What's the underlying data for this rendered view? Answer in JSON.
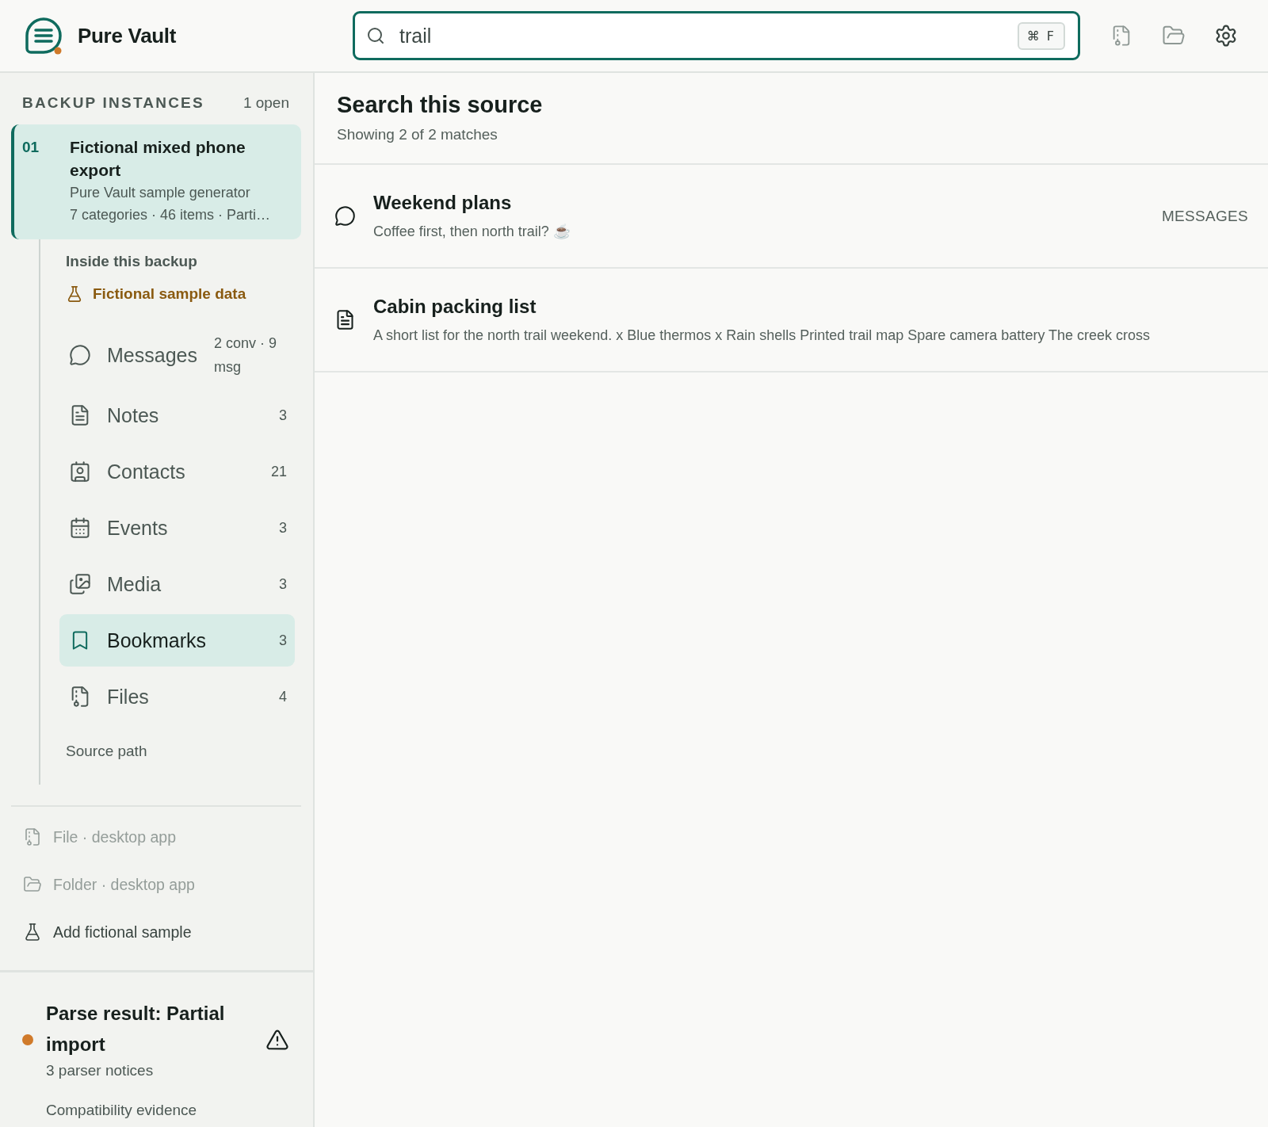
{
  "app": {
    "name": "Pure Vault"
  },
  "search": {
    "value": "trail",
    "shortcut": "⌘ F"
  },
  "sidebar": {
    "heading": "BACKUP INSTANCES",
    "open_count": "1 open",
    "instances": [
      {
        "number": "01",
        "title": "Fictional mixed phone export",
        "source": "Pure Vault sample generator",
        "summary": "7 categories · 46 items · Parti…",
        "selected": true
      }
    ],
    "contents": {
      "heading": "Inside this backup",
      "badge": "Fictional sample data",
      "categories": [
        {
          "kind": "messages",
          "label": "Messages",
          "count": "2 conv · 9 msg",
          "selected": false
        },
        {
          "kind": "notes",
          "label": "Notes",
          "count": "3",
          "selected": false
        },
        {
          "kind": "contacts",
          "label": "Contacts",
          "count": "21",
          "selected": false
        },
        {
          "kind": "events",
          "label": "Events",
          "count": "3",
          "selected": false
        },
        {
          "kind": "media",
          "label": "Media",
          "count": "3",
          "selected": false
        },
        {
          "kind": "bookmarks",
          "label": "Bookmarks",
          "count": "3",
          "selected": true
        },
        {
          "kind": "files",
          "label": "Files",
          "count": "4",
          "selected": false
        }
      ],
      "source_path": "Source path"
    },
    "actions": [
      {
        "kind": "file",
        "label": "File · desktop app",
        "disabled": true
      },
      {
        "kind": "folder",
        "label": "Folder · desktop app",
        "disabled": true
      },
      {
        "kind": "sample",
        "label": "Add fictional sample",
        "disabled": false
      }
    ],
    "parse_result": {
      "warning": true,
      "title": "Parse result: Partial import",
      "notices": "3 parser notices",
      "evidence": "Compatibility evidence"
    }
  },
  "main": {
    "title": "Search this source",
    "summary": "Showing 2 of 2 matches",
    "results": [
      {
        "kind": "message",
        "title": "Weekend plans",
        "snippet": "Coffee first, then north trail? ☕",
        "category": "MESSAGES"
      },
      {
        "kind": "note",
        "title": "Cabin packing list",
        "snippet": "A short list for the north trail weekend. x Blue thermos x Rain shells Printed trail map Spare camera battery The creek cross"
      }
    ]
  }
}
